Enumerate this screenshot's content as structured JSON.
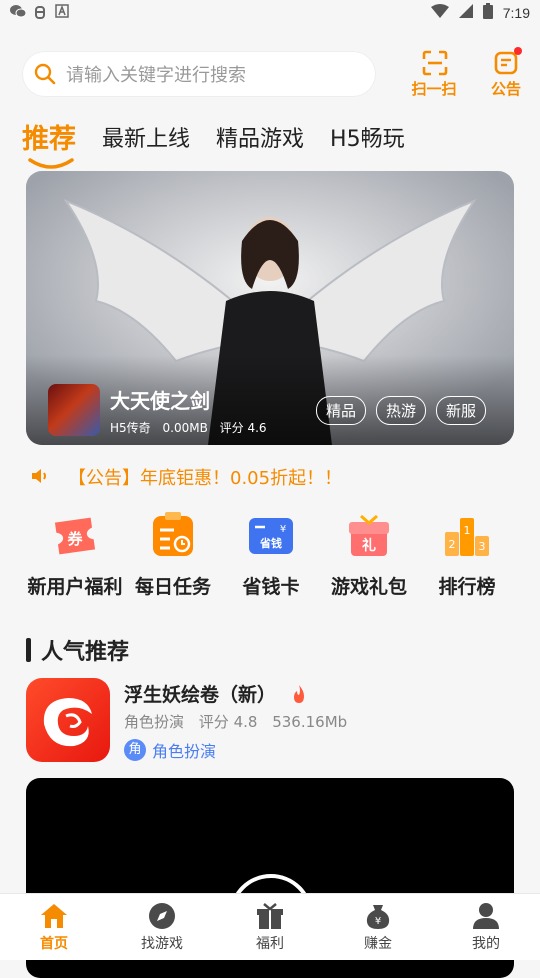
{
  "status_bar": {
    "time": "7:19",
    "left_icons": [
      "wechat-icon",
      "bug-icon",
      "a-icon"
    ],
    "right_icons": [
      "wifi-icon",
      "signal-icon",
      "battery-icon"
    ]
  },
  "header": {
    "search_placeholder": "请输入关键字进行搜索",
    "scan_label": "扫一扫",
    "notice_label": "公告"
  },
  "tabs": [
    {
      "label": "推荐",
      "active": true
    },
    {
      "label": "最新上线",
      "active": false
    },
    {
      "label": "精品游戏",
      "active": false
    },
    {
      "label": "H5畅玩",
      "active": false
    }
  ],
  "banner": {
    "game_name": "大天使之剑",
    "category": "H5传奇",
    "size": "0.00MB",
    "rating": "评分 4.6",
    "tags": [
      "精品",
      "热游",
      "新服"
    ]
  },
  "announcement": "【公告】年底钜惠！0.05折起！！",
  "quick_menu": [
    {
      "label": "新用户福利",
      "icon": "coupon-icon",
      "icon_text": "券"
    },
    {
      "label": "每日任务",
      "icon": "task-icon",
      "icon_text": ""
    },
    {
      "label": "省钱卡",
      "icon": "card-icon",
      "icon_text": "省钱"
    },
    {
      "label": "游戏礼包",
      "icon": "gift-icon",
      "icon_text": "礼"
    },
    {
      "label": "排行榜",
      "icon": "podium-icon",
      "icon_text": ""
    }
  ],
  "section": {
    "title": "人气推荐"
  },
  "app": {
    "name": "浮生妖绘卷（新）",
    "genre": "角色扮演",
    "rating": "评分 4.8",
    "size": "536.16Mb",
    "tag_icon": "角",
    "tag_label": "角色扮演"
  },
  "bottom_nav": [
    {
      "label": "首页",
      "icon": "home-icon",
      "active": true
    },
    {
      "label": "找游戏",
      "icon": "compass-icon",
      "active": false
    },
    {
      "label": "福利",
      "icon": "gift-icon",
      "active": false
    },
    {
      "label": "赚金",
      "icon": "money-bag-icon",
      "active": false
    },
    {
      "label": "我的",
      "icon": "user-icon",
      "active": false
    }
  ],
  "colors": {
    "accent": "#f58b00",
    "tag_blue": "#4a7ef0",
    "hot_red": "#ff5a3c"
  }
}
